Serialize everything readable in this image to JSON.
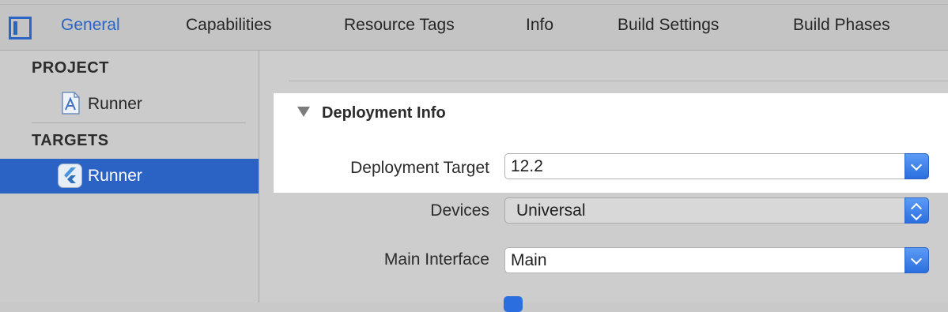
{
  "toolbar": {
    "sidebar_toggle_icon": "sidebar-toggle-icon",
    "tabs": [
      {
        "label": "General",
        "active": true
      },
      {
        "label": "Capabilities",
        "active": false
      },
      {
        "label": "Resource Tags",
        "active": false
      },
      {
        "label": "Info",
        "active": false
      },
      {
        "label": "Build Settings",
        "active": false
      },
      {
        "label": "Build Phases",
        "active": false
      }
    ]
  },
  "sidebar": {
    "project_header": "PROJECT",
    "project_item": {
      "label": "Runner",
      "icon": "xcode-project-icon"
    },
    "targets_header": "TARGETS",
    "target_item": {
      "label": "Runner",
      "icon": "flutter-app-icon",
      "selected": true
    }
  },
  "main": {
    "section_title": "Deployment Info",
    "fields": {
      "deployment_target": {
        "label": "Deployment Target",
        "value": "12.2"
      },
      "devices": {
        "label": "Devices",
        "value": "Universal"
      },
      "main_interface": {
        "label": "Main Interface",
        "value": "Main"
      }
    }
  },
  "colors": {
    "accent": "#2a64c4",
    "selection": "#2a63c3",
    "highlight": "#ffffff"
  }
}
